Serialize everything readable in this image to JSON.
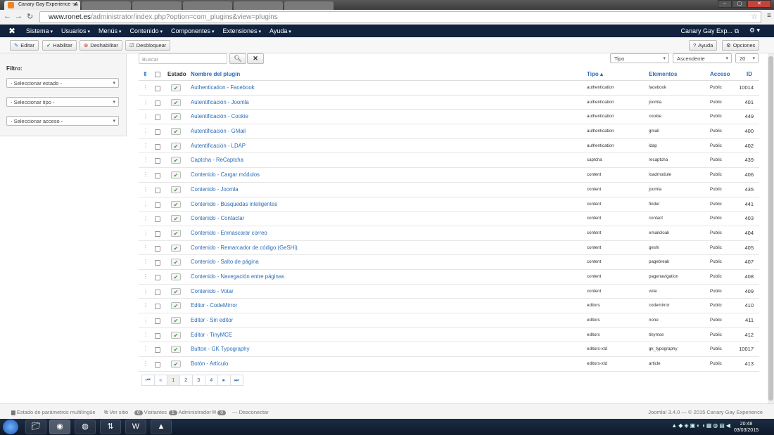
{
  "browser": {
    "active_tab": "Canary Gay Experience - A",
    "inactive_tabs": [
      "",
      "",
      "",
      "",
      "",
      ""
    ],
    "url_host": "www.ronet.es",
    "url_path": "/administrator/index.php?option=com_plugins&view=plugins"
  },
  "topnav": {
    "menu": [
      "Sistema",
      "Usuarios",
      "Menús",
      "Contenido",
      "Componentes",
      "Extensiones",
      "Ayuda"
    ],
    "site": "Canary Gay Exp...",
    "user_icon": "gear-icon"
  },
  "toolbar": {
    "edit": "Editar",
    "enable": "Habilitar",
    "disable": "Deshabilitar",
    "unlock": "Desbloquear",
    "help": "Ayuda",
    "options": "Opciones"
  },
  "sidebar": {
    "filter_label": "Filtro:",
    "status_select": "- Seleccionar estado -",
    "type_select": "- Seleccionar tipo -",
    "access_select": "- Seleccionar acceso -"
  },
  "search": {
    "placeholder": "Buscar"
  },
  "controls": {
    "type_select": "Tipo",
    "order_select": "Ascendente",
    "limit_select": "20"
  },
  "table": {
    "headers": {
      "status": "Estado",
      "name": "Nombre del plugin",
      "type": "Tipo ▴",
      "elements": "Elementos",
      "access": "Acceso",
      "id": "ID"
    },
    "rows": [
      {
        "name": "Authentication - Facebook",
        "type": "authentication",
        "element": "facebook",
        "access": "Public",
        "id": "10014"
      },
      {
        "name": "Autentificación - Joomla",
        "type": "authentication",
        "element": "joomla",
        "access": "Public",
        "id": "401"
      },
      {
        "name": "Autentificación - Cookie",
        "type": "authentication",
        "element": "cookie",
        "access": "Public",
        "id": "449"
      },
      {
        "name": "Autentificación - GMail",
        "type": "authentication",
        "element": "gmail",
        "access": "Public",
        "id": "400"
      },
      {
        "name": "Autentificación - LDAP",
        "type": "authentication",
        "element": "ldap",
        "access": "Public",
        "id": "402"
      },
      {
        "name": "Captcha - ReCaptcha",
        "type": "captcha",
        "element": "recaptcha",
        "access": "Public",
        "id": "439"
      },
      {
        "name": "Contenido - Cargar módulos",
        "type": "content",
        "element": "loadmodule",
        "access": "Public",
        "id": "406"
      },
      {
        "name": "Contenido - Joomla",
        "type": "content",
        "element": "joomla",
        "access": "Public",
        "id": "435"
      },
      {
        "name": "Contenido - Búsquedas inteligentes",
        "type": "content",
        "element": "finder",
        "access": "Public",
        "id": "441"
      },
      {
        "name": "Contenido - Contactar",
        "type": "content",
        "element": "contact",
        "access": "Public",
        "id": "403"
      },
      {
        "name": "Contenido - Enmascarar correo",
        "type": "content",
        "element": "emailcloak",
        "access": "Public",
        "id": "404"
      },
      {
        "name": "Contenido - Remarcador de código (GeSHi)",
        "type": "content",
        "element": "geshi",
        "access": "Public",
        "id": "405"
      },
      {
        "name": "Contenido - Salto de página",
        "type": "content",
        "element": "pagebreak",
        "access": "Public",
        "id": "407"
      },
      {
        "name": "Contenido - Navegación entre páginas",
        "type": "content",
        "element": "pagenavigation",
        "access": "Public",
        "id": "408"
      },
      {
        "name": "Contenido - Votar",
        "type": "content",
        "element": "vote",
        "access": "Public",
        "id": "409"
      },
      {
        "name": "Editor - CodeMirror",
        "type": "editors",
        "element": "codemirror",
        "access": "Public",
        "id": "410"
      },
      {
        "name": "Editor - Sin editor",
        "type": "editors",
        "element": "none",
        "access": "Public",
        "id": "411"
      },
      {
        "name": "Editor - TinyMCE",
        "type": "editors",
        "element": "tinymce",
        "access": "Public",
        "id": "412"
      },
      {
        "name": "Button - GK Typography",
        "type": "editors-xtd",
        "element": "gk_typography",
        "access": "Public",
        "id": "10017"
      },
      {
        "name": "Botón - Artículo",
        "type": "editors-xtd",
        "element": "article",
        "access": "Public",
        "id": "413"
      }
    ]
  },
  "pagination": {
    "first": "⏮",
    "prev": "«",
    "pages": [
      "1",
      "2",
      "3",
      "4"
    ],
    "next": "▸",
    "last": "⏭"
  },
  "statusbar": {
    "multilang": "Estado de parámetros multilingüe",
    "view_site": "Ver sitio",
    "visitors_count": "0",
    "visitors": "Visitantes",
    "admin_count": "1",
    "admin": "Administrador",
    "msg_count": "0",
    "logout": "Desconectar",
    "copyright": "Joomla! 3.4.0 — © 2015 Canary Gay Experience"
  },
  "taskbar": {
    "time": "20:48",
    "date": "03/03/2015"
  }
}
